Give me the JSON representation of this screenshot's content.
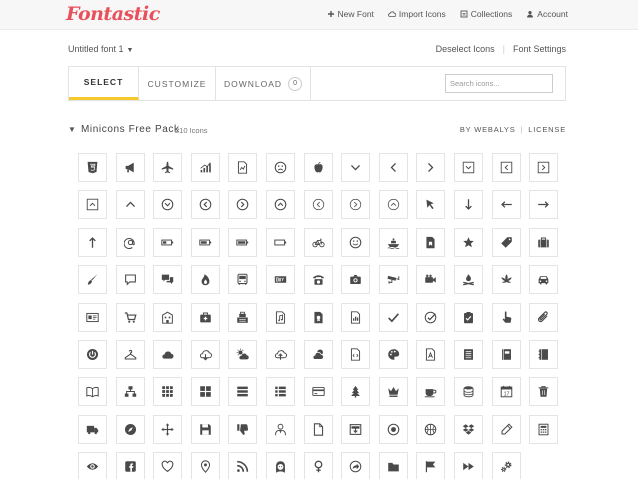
{
  "app": {
    "logo": "Fontastic"
  },
  "topnav": [
    {
      "icon": "plus-icon",
      "label": "New Font"
    },
    {
      "icon": "cloud-import-icon",
      "label": "Import Icons"
    },
    {
      "icon": "collections-icon",
      "label": "Collections"
    },
    {
      "icon": "user-icon",
      "label": "Account"
    }
  ],
  "font": {
    "name": "Untitled font 1",
    "caret": "▼",
    "deselect_label": "Deselect Icons",
    "settings_label": "Font Settings",
    "separator": "|"
  },
  "tabs": [
    {
      "label": "SELECT",
      "active": true
    },
    {
      "label": "CUSTOMIZE",
      "active": false
    },
    {
      "label": "DOWNLOAD",
      "active": false,
      "badge": "0"
    }
  ],
  "search": {
    "placeholder": "Search icons..."
  },
  "pack": {
    "caret": "▼",
    "title": "Minicons Free Pack",
    "count": "210 Icons",
    "author_label": "BY WEBALYS",
    "separator": "|",
    "license_label": "LICENSE"
  },
  "icon_grid": {
    "columns": 13,
    "icons": [
      "html5-icon",
      "megaphone-icon",
      "airplane-icon",
      "signal-bars-icon",
      "chart-document-icon",
      "sad-face-icon",
      "apple-icon",
      "chevron-down-icon",
      "chevron-left-icon",
      "chevron-right-icon",
      "box-chevron-down-icon",
      "box-chevron-left-icon",
      "box-chevron-right-icon",
      "box-chevron-up-icon",
      "chevron-up-icon",
      "circle-chevron-down-icon",
      "circle-chevron-left-icon",
      "circle-chevron-right-icon",
      "circle-chevron-up-icon",
      "circle-outline-chevron-left-icon",
      "circle-outline-chevron-right-icon",
      "circle-outline-chevron-up-icon",
      "cursor-arrow-icon",
      "arrow-down-icon",
      "arrow-left-icon",
      "arrow-right-icon",
      "arrow-up-icon",
      "at-sign-icon",
      "battery-low-icon",
      "battery-mid-icon",
      "battery-high-icon",
      "battery-empty-icon",
      "bicycle-icon",
      "smiley-icon",
      "boat-icon",
      "bookmark-document-icon",
      "star-icon",
      "tag-icon",
      "briefcase-icon",
      "brush-icon",
      "speech-bubble-icon",
      "chat-bubbles-icon",
      "flame-icon",
      "bus-icon",
      "buy-sign-icon",
      "telephone-icon",
      "camera-icon",
      "security-camera-icon",
      "video-camera-icon",
      "campfire-icon",
      "leaf-icon",
      "car-icon",
      "id-card-icon",
      "shopping-cart-icon",
      "building-icon",
      "first-aid-kit-icon",
      "cash-register-icon",
      "music-document-icon",
      "certificate-document-icon",
      "chart-file-icon",
      "checkmark-icon",
      "circle-check-icon",
      "clipboard-check-icon",
      "pointer-hand-icon",
      "paperclip-icon",
      "power-icon",
      "clothes-hanger-icon",
      "cloud-icon",
      "cloud-download-icon",
      "sun-cloud-icon",
      "cloud-upload-icon",
      "cloudy-sun-icon",
      "code-document-icon",
      "palette-icon",
      "file-type-icon",
      "list-document-icon",
      "book-dark-icon",
      "notebook-icon",
      "open-book-icon",
      "sitemap-icon",
      "grid-small-icon",
      "grid-large-icon",
      "list-rows-icon",
      "list-bullets-icon",
      "credit-card-icon",
      "tree-icon",
      "crown-icon",
      "coffee-cup-icon",
      "database-icon",
      "calendar-icon",
      "trash-icon",
      "truck-icon",
      "compass-icon",
      "move-arrows-icon",
      "floppy-disk-icon",
      "thumbs-down-icon",
      "person-icon",
      "blank-document-icon",
      "image-download-icon",
      "record-icon",
      "basketball-icon",
      "dropbox-icon",
      "pencil-icon",
      "calculator-document-icon",
      "eye-icon",
      "facebook-icon",
      "heart-icon",
      "map-pin-icon",
      "rss-feed-icon",
      "girl-face-icon",
      "female-symbol-icon",
      "forward-circle-icon",
      "folder-icon",
      "flag-icon",
      "fast-forward-icon",
      "gears-icon"
    ]
  }
}
